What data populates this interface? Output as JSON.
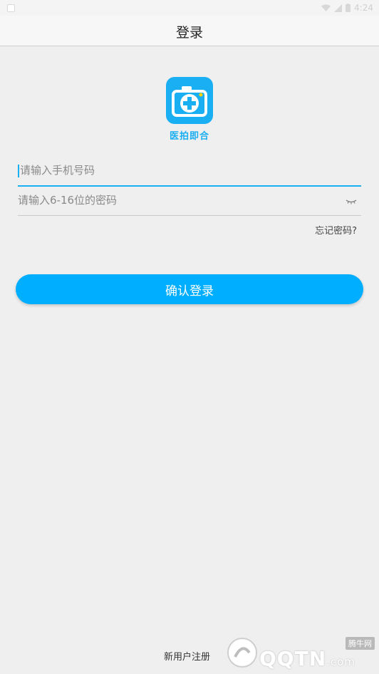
{
  "status_bar": {
    "time": "4:24"
  },
  "header": {
    "title": "登录"
  },
  "logo": {
    "text": "医拍即合",
    "icon": "camera-medical-cross-icon",
    "color": "#1aaef2"
  },
  "form": {
    "phone_placeholder": "请输入手机号码",
    "password_placeholder": "请输入6-16位的密码",
    "forgot_password": "忘记密码?",
    "submit_label": "确认登录"
  },
  "footer": {
    "register_label": "新用户注册"
  },
  "watermark": {
    "text": "QQTN",
    "suffix": ".com",
    "badge": "腾牛网"
  },
  "colors": {
    "accent": "#00aeff",
    "background": "#efefef"
  }
}
